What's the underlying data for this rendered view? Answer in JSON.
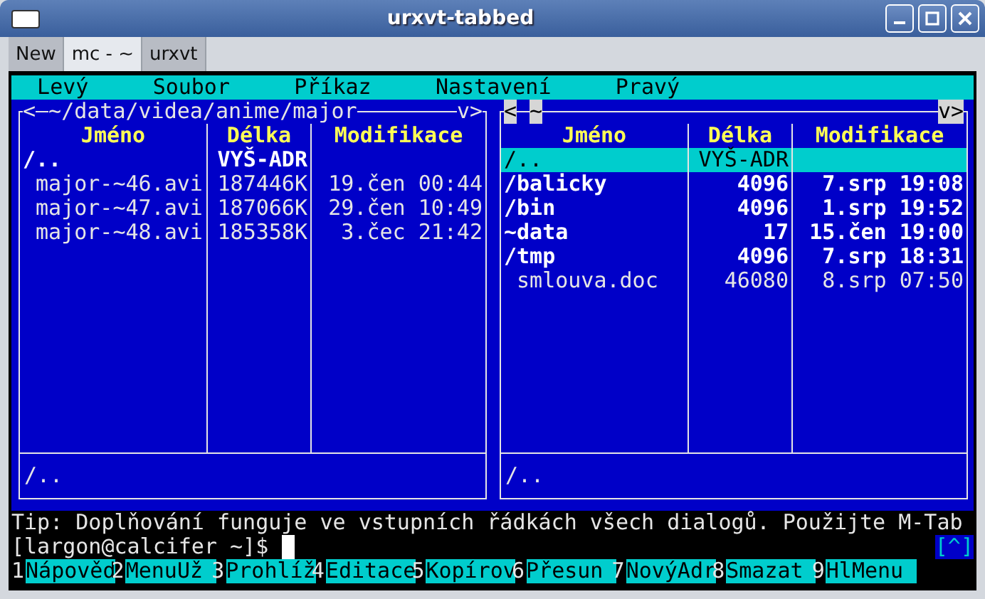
{
  "window": {
    "title": "urxvt-tabbed"
  },
  "tabs": [
    {
      "label": "New",
      "selected": false
    },
    {
      "label": "mc - ~",
      "selected": true
    },
    {
      "label": "urxvt",
      "selected": false
    }
  ],
  "menu": [
    "Levý",
    "Soubor",
    "Příkaz",
    "Nastavení",
    "Pravý"
  ],
  "panels": [
    {
      "active": false,
      "path_open": "<",
      "path": "~/data/videa/anime/major",
      "path_close": "v>",
      "columns": [
        "Jméno",
        "Délka",
        "Modifikace"
      ],
      "rows": [
        {
          "kind": "dir",
          "name": "/..",
          "size": "VYŠ-ADR",
          "selected": false
        },
        {
          "kind": "file",
          "name": "major-~46.avi",
          "size": "187446K",
          "modified": "19.čen 00:44",
          "selected": false
        },
        {
          "kind": "file",
          "name": "major-~47.avi",
          "size": "187066K",
          "modified": "29.čen 10:49",
          "selected": false
        },
        {
          "kind": "file",
          "name": "major-~48.avi",
          "size": "185358K",
          "modified": "3.čec 21:42",
          "selected": false
        }
      ],
      "status": "/.."
    },
    {
      "active": true,
      "path_open": "<",
      "path": "~",
      "path_close": "v>",
      "columns": [
        "Jméno",
        "Délka",
        "Modifikace"
      ],
      "rows": [
        {
          "kind": "dir",
          "name": "/..",
          "size": "VYŠ-ADR",
          "selected": true
        },
        {
          "kind": "dir",
          "name": "/balicky",
          "size": "4096",
          "modified": "7.srp 19:08",
          "selected": false
        },
        {
          "kind": "dir",
          "name": "/bin",
          "size": "4096",
          "modified": "1.srp 19:52",
          "selected": false
        },
        {
          "kind": "dir",
          "name": "~data",
          "size": "17",
          "modified": "15.čen 19:00",
          "selected": false
        },
        {
          "kind": "dir",
          "name": "/tmp",
          "size": "4096",
          "modified": "7.srp 18:31",
          "selected": false
        },
        {
          "kind": "file",
          "name": "smlouva.doc",
          "size": "46080",
          "modified": "8.srp 07:50",
          "selected": false
        }
      ],
      "status": "/.."
    }
  ],
  "tip": "Tip: Doplňování funguje ve vstupních řádkách všech dialogů. Použijte M-Tab",
  "prompt": "[largon@calcifer ~]$",
  "history_button": "[^]",
  "keybar": [
    {
      "key": "1",
      "label": "Nápověd"
    },
    {
      "key": "2",
      "label": "MenuUž"
    },
    {
      "key": "3",
      "label": "Prohlíž"
    },
    {
      "key": "4",
      "label": "Editace"
    },
    {
      "key": "5",
      "label": "Kopírov"
    },
    {
      "key": "6",
      "label": "Přesun"
    },
    {
      "key": "7",
      "label": "NovýAdr"
    },
    {
      "key": "8",
      "label": "Smazat"
    },
    {
      "key": "9",
      "label": "HlMenu"
    }
  ]
}
